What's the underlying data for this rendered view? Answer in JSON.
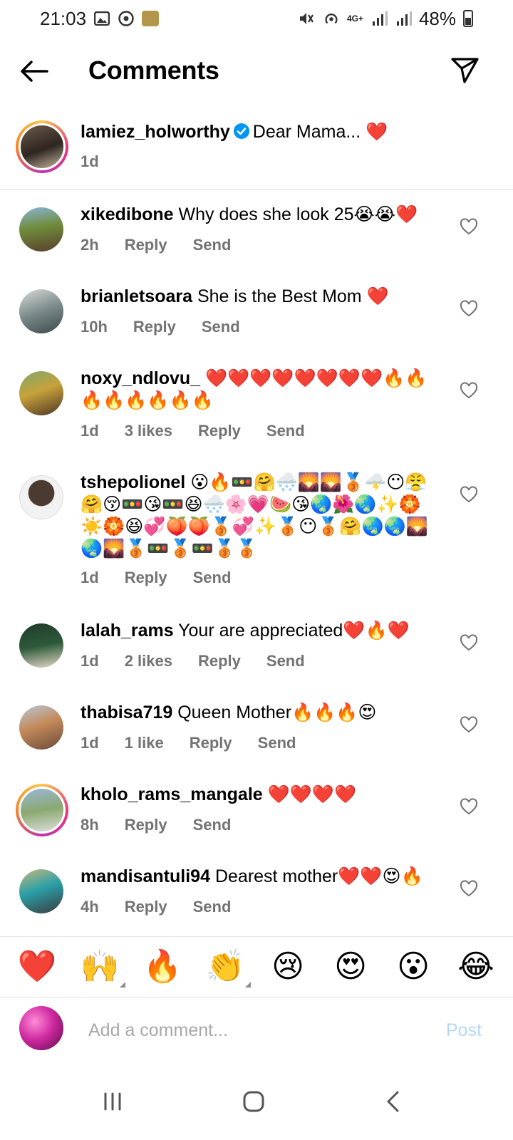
{
  "status_bar": {
    "time": "21:03",
    "battery": "48%",
    "network": "4G+"
  },
  "header": {
    "title": "Comments"
  },
  "caption": {
    "username": "lamiez_holworthy",
    "text": "Dear Mama... ❤️",
    "time": "1d"
  },
  "comments": [
    {
      "username": "xikedibone",
      "text": "Why does she look 25😭😭❤️",
      "time": "2h",
      "likes": "",
      "reply": "Reply",
      "send": "Send"
    },
    {
      "username": "brianletsoara",
      "text": "She is the Best Mom ❤️",
      "time": "10h",
      "likes": "",
      "reply": "Reply",
      "send": "Send"
    },
    {
      "username": "noxy_ndlovu_",
      "text": "❤️❤️❤️❤️❤️❤️❤️❤️🔥🔥🔥🔥🔥🔥🔥🔥",
      "time": "1d",
      "likes": "3 likes",
      "reply": "Reply",
      "send": "Send"
    },
    {
      "username": "tshepolionel",
      "text": "😮🔥🚥🤗🌨️🌄🌄🥉🌩️😶😤🤗😚🚥😘🚥😆🌨️🌸💗🍉😘🌏🌺🌏✨🏵️☀️🏵️😆💞🍑🍑🥉💞✨🥉😶🥉🤗🌏🌏🌄🌏🌄🥉🚥🥉🚥🥉🥉",
      "time": "1d",
      "likes": "",
      "reply": "Reply",
      "send": "Send"
    },
    {
      "username": "lalah_rams",
      "text": "Your are appreciated❤️🔥❤️",
      "time": "1d",
      "likes": "2 likes",
      "reply": "Reply",
      "send": "Send"
    },
    {
      "username": "thabisa719",
      "text": "Queen Mother🔥🔥🔥😍",
      "time": "1d",
      "likes": "1 like",
      "reply": "Reply",
      "send": "Send"
    },
    {
      "username": "kholo_rams_mangale",
      "text": "❤️❤️❤️❤️",
      "time": "8h",
      "likes": "",
      "reply": "Reply",
      "send": "Send"
    },
    {
      "username": "mandisantuli94",
      "text": "Dearest mother❤️❤️😍🔥",
      "time": "4h",
      "likes": "",
      "reply": "Reply",
      "send": "Send"
    }
  ],
  "reactions": [
    "❤️",
    "🙌",
    "🔥",
    "👏",
    "😢",
    "😍",
    "😮",
    "😂"
  ],
  "composer": {
    "placeholder": "Add a comment...",
    "post_label": "Post"
  },
  "colors": {
    "link_blue": "#b3d8fb",
    "muted": "#737373",
    "verified": "#0095f6"
  }
}
